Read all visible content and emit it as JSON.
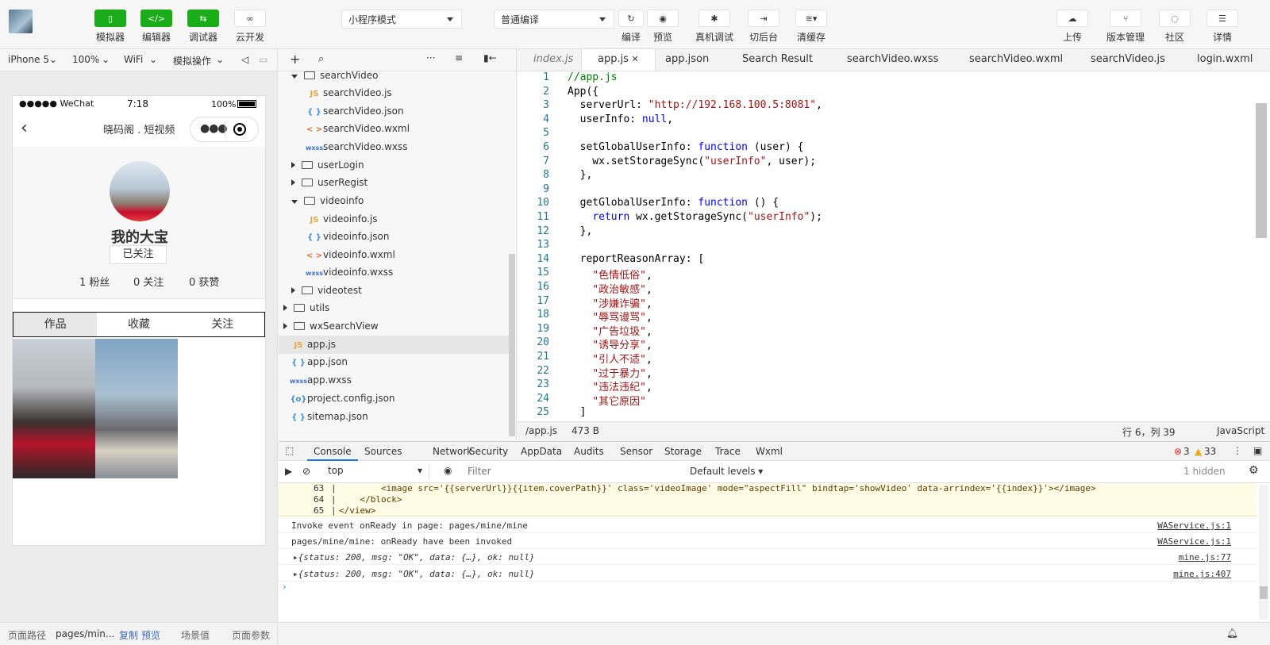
{
  "toolbar": {
    "left_buttons": [
      {
        "label": "模拟器",
        "icon": "phone-icon"
      },
      {
        "label": "编辑器",
        "icon": "code-icon"
      },
      {
        "label": "调试器",
        "icon": "debug-arrows-icon"
      },
      {
        "label": "云开发",
        "icon": "cloud-link-icon"
      }
    ],
    "mode_select": "小程序模式",
    "compile_select": "普通编译",
    "mid_buttons": [
      {
        "label": "编译",
        "icon": "refresh-icon"
      },
      {
        "label": "预览",
        "icon": "eye-icon"
      },
      {
        "label": "真机调试",
        "icon": "bug-icon"
      },
      {
        "label": "切后台",
        "icon": "switch-icon"
      },
      {
        "label": "清缓存",
        "icon": "layers-icon"
      }
    ],
    "right_buttons": [
      {
        "label": "上传",
        "icon": "upload-icon"
      },
      {
        "label": "版本管理",
        "icon": "branch-icon"
      },
      {
        "label": "社区",
        "icon": "chat-icon"
      },
      {
        "label": "详情",
        "icon": "menu-icon"
      }
    ]
  },
  "simbar": {
    "device": "iPhone 5",
    "zoom": "100%",
    "network": "WiFi",
    "ops": "模拟操作"
  },
  "phone": {
    "carrier": "●●●●● WeChat",
    "time": "7:18",
    "battery": "100%",
    "nav_title": "晓码阁 . 短视频",
    "nickname": "我的大宝",
    "follow_state": "已关注",
    "fans": "1 粉丝",
    "following": "0 关注",
    "likes": "0 获赞",
    "tabs": [
      "作品",
      "收藏",
      "关注"
    ]
  },
  "simfoot": {
    "path_label": "页面路径",
    "path": "pages/min...",
    "copy": "复制",
    "preview": "预览",
    "scene": "场景值",
    "params": "页面参数"
  },
  "tree": {
    "items": [
      {
        "label": "searchVideo",
        "type": "folder-open",
        "indent": 1
      },
      {
        "label": "searchVideo.js",
        "type": "js",
        "indent": 2
      },
      {
        "label": "searchVideo.json",
        "type": "json",
        "indent": 2
      },
      {
        "label": "searchVideo.wxml",
        "type": "wxml",
        "indent": 2
      },
      {
        "label": "searchVideo.wxss",
        "type": "wxss",
        "indent": 2
      },
      {
        "label": "userLogin",
        "type": "folder",
        "indent": 1
      },
      {
        "label": "userRegist",
        "type": "folder",
        "indent": 1
      },
      {
        "label": "videoinfo",
        "type": "folder-open",
        "indent": 1
      },
      {
        "label": "videoinfo.js",
        "type": "js",
        "indent": 2
      },
      {
        "label": "videoinfo.json",
        "type": "json",
        "indent": 2
      },
      {
        "label": "videoinfo.wxml",
        "type": "wxml",
        "indent": 2
      },
      {
        "label": "videoinfo.wxss",
        "type": "wxss",
        "indent": 2
      },
      {
        "label": "videotest",
        "type": "folder",
        "indent": 1
      },
      {
        "label": "utils",
        "type": "folder",
        "indent": 0
      },
      {
        "label": "wxSearchView",
        "type": "folder",
        "indent": 0
      },
      {
        "label": "app.js",
        "type": "js",
        "indent": 0,
        "selected": true
      },
      {
        "label": "app.json",
        "type": "json",
        "indent": 0
      },
      {
        "label": "app.wxss",
        "type": "wxss",
        "indent": 0
      },
      {
        "label": "project.config.json",
        "type": "config",
        "indent": 0
      },
      {
        "label": "sitemap.json",
        "type": "json",
        "indent": 0
      }
    ]
  },
  "editor": {
    "tabs": [
      "index.js",
      "app.js",
      "app.json",
      "Search Result",
      "searchVideo.wxss",
      "searchVideo.wxml",
      "searchVideo.js",
      "login.wxml"
    ],
    "active_tab": "app.js",
    "lines": [
      "//app.js",
      "App({",
      "  serverUrl: \"http://192.168.100.5:8081\",",
      "  userInfo: null,",
      "",
      "  setGlobalUserInfo: function (user) {",
      "    wx.setStorageSync(\"userInfo\", user);",
      "  },",
      "",
      "  getGlobalUserInfo: function () {",
      "    return wx.getStorageSync(\"userInfo\");",
      "  },",
      "",
      "  reportReasonArray: [",
      "    \"色情低俗\",",
      "    \"政治敏感\",",
      "    \"涉嫌诈骗\",",
      "    \"辱骂谩骂\",",
      "    \"广告垃圾\",",
      "    \"诱导分享\",",
      "    \"引人不适\",",
      "    \"过于暴力\",",
      "    \"违法违纪\",",
      "    \"其它原因\"",
      "  ]"
    ],
    "status_path": "/app.js",
    "status_size": "473 B",
    "status_pos": "行 6，列 39",
    "status_lang": "JavaScript"
  },
  "devtools": {
    "tabs": [
      "Console",
      "Sources",
      "Network",
      "Security",
      "AppData",
      "Audits",
      "Sensor",
      "Storage",
      "Trace",
      "Wxml"
    ],
    "errors": "3",
    "warnings": "33",
    "context": "top",
    "filter_placeholder": "Filter",
    "levels": "Default levels",
    "hidden": "1 hidden",
    "warn_lines": [
      {
        "n": "63",
        "text": "        <image src='{{serverUrl}}{{item.coverPath}}' class='videoImage' mode=\"aspectFill\" bindtap='showVideo' data-arrindex='{{index}}'></image>"
      },
      {
        "n": "64",
        "text": "    </block>"
      },
      {
        "n": "65",
        "text": "</view>"
      }
    ],
    "logs": [
      {
        "text": "Invoke event onReady in page: pages/mine/mine",
        "src": "WAService.js:1"
      },
      {
        "text": "pages/mine/mine: onReady have been invoked",
        "src": "WAService.js:1"
      },
      {
        "text": "▸{status: 200, msg: \"OK\", data: {…}, ok: null}",
        "src": "mine.js:77"
      },
      {
        "text": "▸{status: 200, msg: \"OK\", data: {…}, ok: null}",
        "src": "mine.js:407"
      }
    ]
  }
}
